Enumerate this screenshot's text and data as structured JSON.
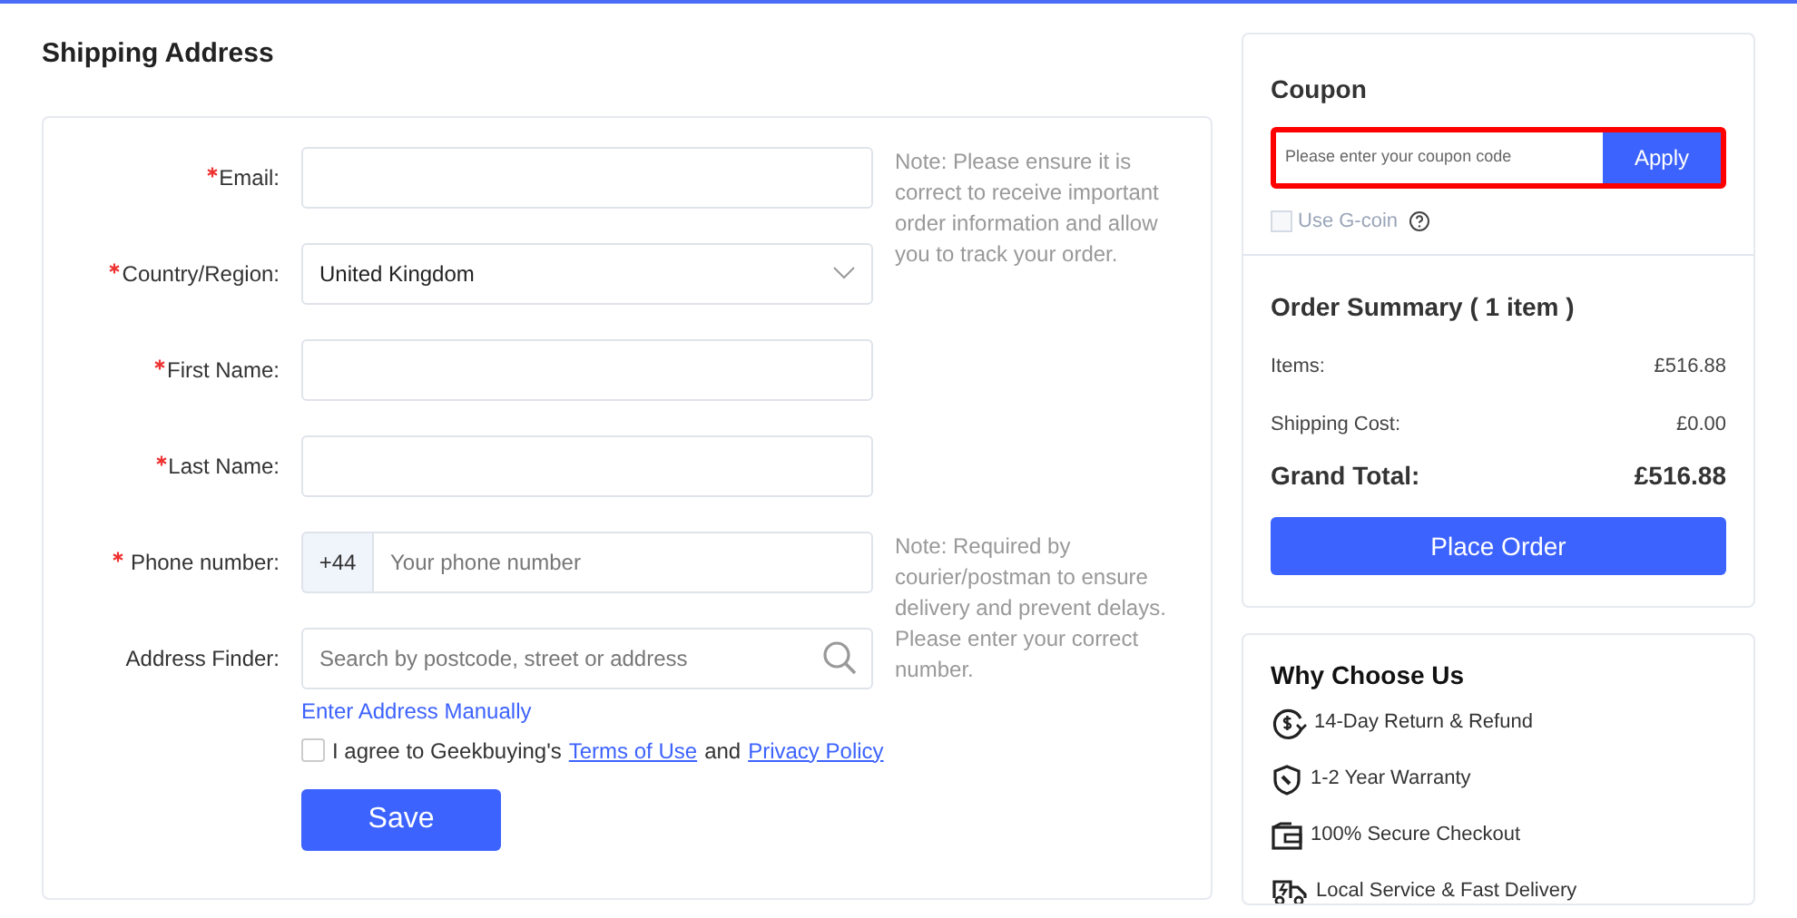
{
  "shipping": {
    "title": "Shipping Address",
    "fields": [
      {
        "kind": "text",
        "label": "Email:",
        "required": true,
        "note": "Note: Please ensure it is correct to receive important order information and allow you to track your order."
      },
      {
        "kind": "select",
        "label": "Country/Region:",
        "required": true,
        "value": "United Kingdom"
      },
      {
        "kind": "text",
        "label": "First Name:",
        "required": true
      },
      {
        "kind": "text",
        "label": "Last Name:",
        "required": true
      },
      {
        "kind": "phone",
        "label": "Phone number:",
        "required": true,
        "prefix": "+44",
        "placeholder": "Your phone number",
        "note": "Note: Required by courier/postman to ensure delivery and prevent delays. Please enter your correct number."
      },
      {
        "kind": "search",
        "label": "Address Finder:",
        "required": false,
        "placeholder": "Search by postcode, street or address"
      }
    ],
    "manual_link": "Enter Address Manually",
    "agreement": {
      "checked": false,
      "text": "I agree to Geekbuying's",
      "terms": "Terms of Use",
      "and": "and",
      "privacy": "Privacy Policy"
    },
    "save": "Save"
  },
  "coupon": {
    "title": "Coupon",
    "placeholder": "Please enter your coupon code",
    "apply": "Apply",
    "gcoin": {
      "label": "Use G-coin",
      "disabled": true,
      "checked": false
    }
  },
  "summary": {
    "title": "Order Summary ( 1 item )",
    "rows": [
      {
        "label": "Items:",
        "value": "£516.88"
      },
      {
        "label": "Shipping Cost:",
        "value": "£0.00"
      }
    ],
    "total": {
      "label": "Grand Total:",
      "value": "£516.88"
    },
    "button": "Place Order"
  },
  "why": {
    "title": "Why Choose Us",
    "items": [
      {
        "kind": "refund",
        "text": "14-Day Return & Refund"
      },
      {
        "kind": "warranty",
        "text": "1-2 Year Warranty"
      },
      {
        "kind": "secure",
        "text": "100% Secure Checkout"
      },
      {
        "kind": "delivery",
        "text": "Local Service & Fast Delivery"
      }
    ]
  }
}
